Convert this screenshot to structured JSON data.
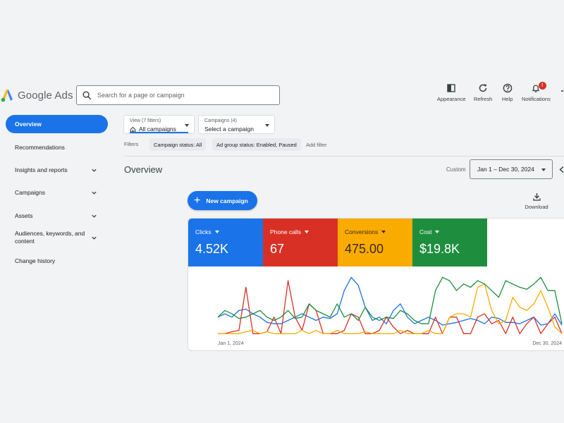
{
  "app": {
    "logo_text": "Google Ads"
  },
  "search": {
    "placeholder": "Search for a page or campaign"
  },
  "header_actions": [
    {
      "label": "Appearance",
      "icon": "appearance-icon"
    },
    {
      "label": "Refresh",
      "icon": "refresh-icon"
    },
    {
      "label": "Help",
      "icon": "help-icon"
    },
    {
      "label": "Notifications",
      "icon": "bell-icon",
      "badge": "!"
    }
  ],
  "sidebar": {
    "items": [
      {
        "label": "Overview",
        "active": true
      },
      {
        "label": "Recommendations"
      },
      {
        "label": "Insights and reports",
        "expandable": true
      },
      {
        "label": "Campaigns",
        "expandable": true
      },
      {
        "label": "Assets",
        "expandable": true
      },
      {
        "label": "Audiences, keywords, and content",
        "expandable": true
      },
      {
        "label": "Change history"
      }
    ]
  },
  "filters": {
    "view": {
      "small": "View (7 filters)",
      "value": "All campaigns"
    },
    "campaigns": {
      "small": "Campaigns (4)",
      "value": "Select a campaign"
    },
    "label": "Filters",
    "chips": [
      "Campaign status: All",
      "Ad group status: Enabled, Paused"
    ],
    "add_filter": "Add filter"
  },
  "overview": {
    "title": "Overview",
    "range_label": "Custom",
    "date_range": "Jan 1 – Dec 30, 2024",
    "new_campaign": "New campaign",
    "download": "Download"
  },
  "metrics": [
    {
      "label": "Clicks",
      "value": "4.52K",
      "color": "#1a73e8"
    },
    {
      "label": "Phone calls",
      "value": "67",
      "color": "#d93025"
    },
    {
      "label": "Conversions",
      "value": "475.00",
      "color": "#f9ab00"
    },
    {
      "label": "Cost",
      "value": "$19.8K",
      "color": "#1e8e3e"
    }
  ],
  "chart_data": {
    "type": "line",
    "x_start_label": "Jan 1, 2024",
    "x_end_label": "Dec 30, 2024",
    "grid": false,
    "legend": "none",
    "ylim": [
      0,
      100
    ],
    "series": [
      {
        "color": "#1a73e8",
        "values": [
          30,
          35,
          30,
          40,
          42,
          35,
          30,
          22,
          20,
          20,
          25,
          30,
          35,
          30,
          25,
          30,
          28,
          35,
          70,
          90,
          78,
          45,
          25,
          30,
          20,
          40,
          50,
          30,
          20,
          25,
          30,
          25,
          18,
          20,
          22,
          25,
          28,
          25,
          20,
          30,
          28,
          22,
          22,
          20,
          25,
          30,
          18,
          20,
          35,
          18
        ]
      },
      {
        "color": "#d93025",
        "values": [
          5,
          5,
          8,
          10,
          75,
          5,
          5,
          8,
          30,
          5,
          85,
          30,
          10,
          50,
          40,
          5,
          5,
          5,
          10,
          35,
          30,
          5,
          5,
          10,
          30,
          15,
          5,
          10,
          5,
          5,
          5,
          30,
          5,
          30,
          30,
          5,
          5,
          30,
          35,
          20,
          25,
          5,
          30,
          5,
          20,
          30,
          5,
          20,
          30,
          5
        ]
      },
      {
        "color": "#f9ab00",
        "values": [
          5,
          5,
          5,
          5,
          8,
          10,
          5,
          8,
          5,
          5,
          5,
          5,
          10,
          5,
          10,
          5,
          5,
          10,
          5,
          5,
          5,
          8,
          5,
          5,
          5,
          5,
          10,
          5,
          5,
          5,
          10,
          5,
          5,
          30,
          35,
          35,
          30,
          75,
          80,
          40,
          20,
          25,
          60,
          45,
          40,
          50,
          70,
          45,
          15,
          5
        ]
      },
      {
        "color": "#1e8e3e",
        "values": [
          30,
          40,
          35,
          28,
          30,
          35,
          40,
          30,
          25,
          30,
          40,
          28,
          30,
          50,
          40,
          35,
          30,
          50,
          30,
          35,
          25,
          45,
          30,
          25,
          30,
          28,
          40,
          35,
          25,
          20,
          20,
          70,
          90,
          85,
          70,
          80,
          75,
          85,
          80,
          70,
          60,
          85,
          80,
          75,
          72,
          80,
          90,
          70,
          70,
          20
        ]
      }
    ]
  }
}
